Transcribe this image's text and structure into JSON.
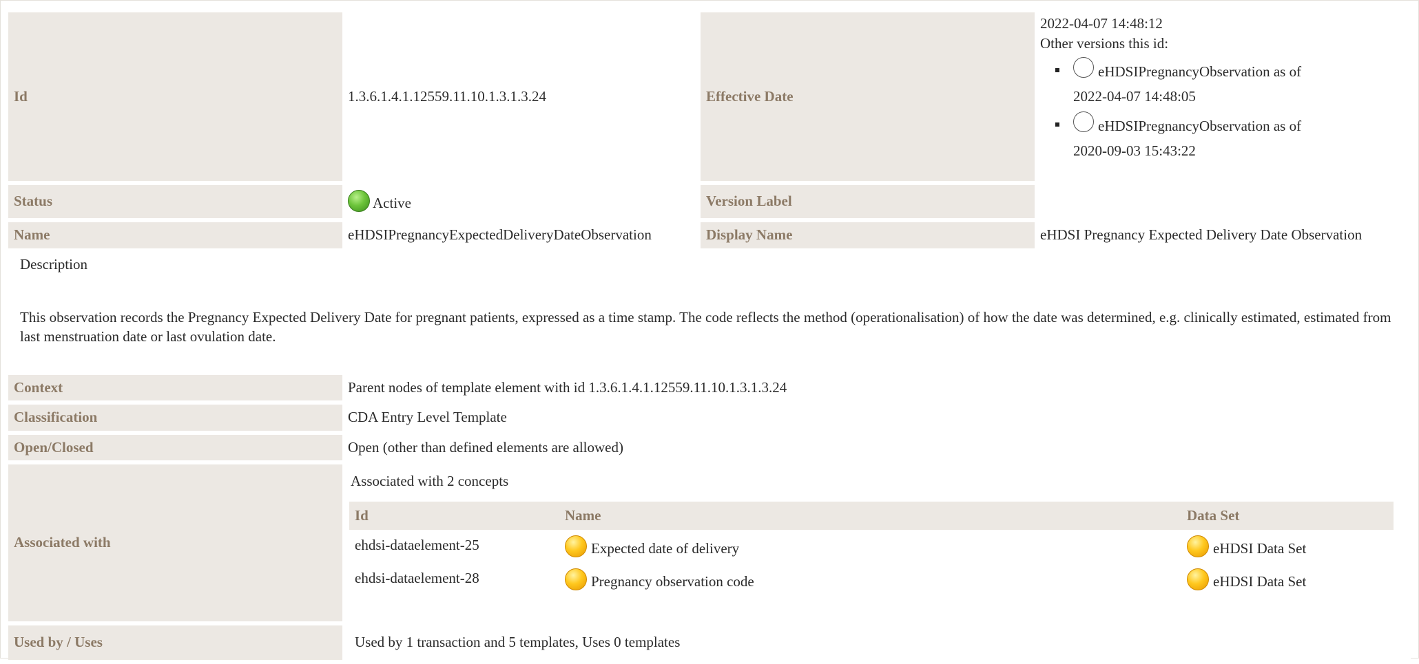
{
  "header": {
    "id_label": "Id",
    "id_value": "1.3.6.1.4.1.12559.11.10.1.3.1.3.24",
    "effective_label": "Effective Date",
    "effective_value": "2022-04-07 14:48:12",
    "other_versions_label": "Other versions this id:",
    "other_versions": [
      {
        "name": "eHDSIPregnancyObservation as of",
        "date": "2022-04-07 14:48:05"
      },
      {
        "name": "eHDSIPregnancyObservation as of",
        "date": "2020-09-03 15:43:22"
      }
    ],
    "status_label": "Status",
    "status_value": "Active",
    "status_color": "#5fb832",
    "version_label": "Version Label",
    "version_value": "",
    "name_label": "Name",
    "name_value": "eHDSIPregnancyExpectedDeliveryDateObservation",
    "display_name_label": "Display Name",
    "display_name_value": "eHDSI Pregnancy Expected Delivery Date Observation"
  },
  "description": {
    "title": "Description",
    "text": "This observation records the Pregnancy Expected Delivery Date for pregnant patients, expressed as a time stamp. The code reflects the method (operationalisation) of how the date was determined, e.g. clinically estimated, estimated from last menstruation date or last ovulation date."
  },
  "details": {
    "context_label": "Context",
    "context_value": "Parent nodes of template element with id 1.3.6.1.4.1.12559.11.10.1.3.1.3.24",
    "classification_label": "Classification",
    "classification_value": "CDA Entry Level Template",
    "open_closed_label": "Open/Closed",
    "open_closed_value": "Open (other than defined elements are allowed)",
    "associated_label": "Associated with",
    "associated_caption": "Associated with 2 concepts",
    "concepts_headers": {
      "id": "Id",
      "name": "Name",
      "dataset": "Data Set"
    },
    "concepts": [
      {
        "id": "ehdsi-dataelement-25",
        "name": "Expected date of delivery",
        "dataset": "eHDSI Data Set"
      },
      {
        "id": "ehdsi-dataelement-28",
        "name": "Pregnancy observation code",
        "dataset": "eHDSI Data Set"
      }
    ],
    "concept_color": "#f5b800",
    "used_by_label": "Used by / Uses",
    "used_by_value": "Used by 1 transaction and 5 templates, Uses 0 templates"
  },
  "colors": {
    "label_bg": "#ece8e3",
    "label_text": "#8c7a66"
  }
}
